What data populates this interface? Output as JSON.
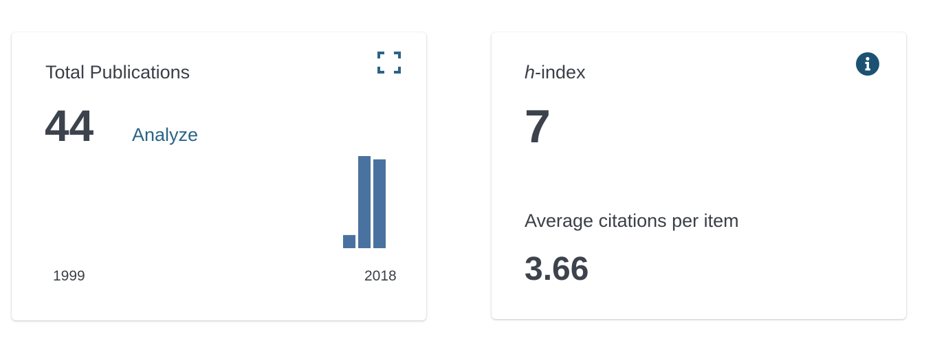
{
  "publications_card": {
    "title": "Total Publications",
    "total": "44",
    "analyze_label": "Analyze",
    "expand_icon": "expand-icon",
    "year_start": "1999",
    "year_end": "2018"
  },
  "chart_data": {
    "type": "bar",
    "values": [
      2,
      14,
      13.5
    ],
    "ylim": [
      0,
      14
    ],
    "xlabel": "",
    "ylabel": "",
    "x_tick_labels": [
      "1999",
      "2018"
    ],
    "grid": false,
    "color": "#4a72a0"
  },
  "hindex_card": {
    "title_italic": "h",
    "title_rest": "-index",
    "value": "7",
    "info_icon": "info-icon",
    "avg_label": "Average citations per item",
    "avg_value": "3.66"
  },
  "colors": {
    "accent": "#2b6486",
    "bar": "#4a72a0",
    "info_icon": "#1b5273",
    "text": "#3d434d"
  }
}
